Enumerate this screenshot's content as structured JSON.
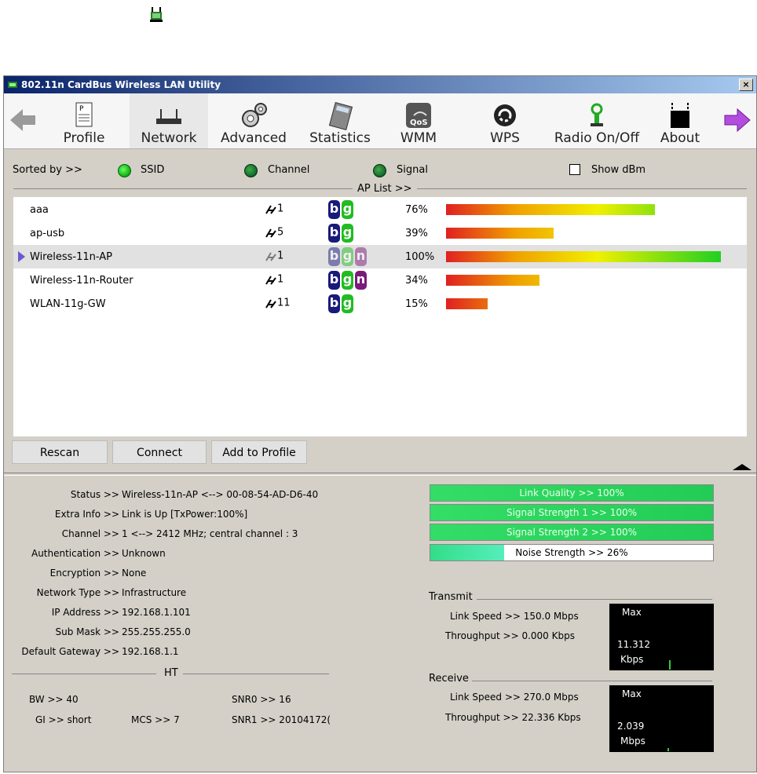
{
  "window": {
    "title": "802.11n CardBus Wireless LAN Utility",
    "close_label": "×"
  },
  "toolbar": {
    "items": [
      {
        "label": "Profile",
        "icon": "profile-icon"
      },
      {
        "label": "Network",
        "icon": "router-icon"
      },
      {
        "label": "Advanced",
        "icon": "gears-icon"
      },
      {
        "label": "Statistics",
        "icon": "calculator-icon"
      },
      {
        "label": "WMM",
        "icon": "qos-icon"
      },
      {
        "label": "WPS",
        "icon": "wps-icon"
      },
      {
        "label": "Radio On/Off",
        "icon": "antenna-icon"
      },
      {
        "label": "About",
        "icon": "about-icon"
      }
    ]
  },
  "sort": {
    "label": "Sorted by >>",
    "ssid": "SSID",
    "channel": "Channel",
    "signal": "Signal",
    "show_dbm": "Show dBm",
    "selected": "SSID"
  },
  "ap_list": {
    "header": "AP List >>",
    "rows": [
      {
        "ssid": "aaa",
        "channel": "1",
        "modes": [
          "b",
          "g"
        ],
        "signal": "76%",
        "signal_value": 76,
        "selected": false
      },
      {
        "ssid": "ap-usb",
        "channel": "5",
        "modes": [
          "b",
          "g"
        ],
        "signal": "39%",
        "signal_value": 39,
        "selected": false
      },
      {
        "ssid": "Wireless-11n-AP",
        "channel": "1",
        "modes": [
          "b",
          "g",
          "n"
        ],
        "signal": "100%",
        "signal_value": 100,
        "selected": true
      },
      {
        "ssid": "Wireless-11n-Router",
        "channel": "1",
        "modes": [
          "b",
          "g",
          "n"
        ],
        "signal": "34%",
        "signal_value": 34,
        "selected": false
      },
      {
        "ssid": "WLAN-11g-GW",
        "channel": "11",
        "modes": [
          "b",
          "g"
        ],
        "signal": "15%",
        "signal_value": 15,
        "selected": false
      }
    ]
  },
  "buttons": {
    "rescan": "Rescan",
    "connect": "Connect",
    "add_to_profile": "Add to Profile"
  },
  "status": {
    "status_label": "Status >>",
    "status_value": "Wireless-11n-AP <--> 00-08-54-AD-D6-40",
    "extra_label": "Extra Info >>",
    "extra_value": "Link is Up [TxPower:100%]",
    "channel_label": "Channel >>",
    "channel_value": "1 <--> 2412 MHz; central channel : 3",
    "auth_label": "Authentication >>",
    "auth_value": "Unknown",
    "enc_label": "Encryption >>",
    "enc_value": "None",
    "nettype_label": "Network Type >>",
    "nettype_value": "Infrastructure",
    "ip_label": "IP Address >>",
    "ip_value": "192.168.1.101",
    "mask_label": "Sub Mask >>",
    "mask_value": "255.255.255.0",
    "gw_label": "Default Gateway >>",
    "gw_value": "192.168.1.1"
  },
  "ht": {
    "header": "HT",
    "bw": "BW >> 40",
    "gi": "GI >> short",
    "mcs": "MCS >> 7",
    "snr0": "SNR0 >> 16",
    "snr1": "SNR1 >> 20104172("
  },
  "meters": [
    {
      "label": "Link Quality >> 100%",
      "value": 100
    },
    {
      "label": "Signal Strength 1 >> 100%",
      "value": 100
    },
    {
      "label": "Signal Strength 2 >> 100%",
      "value": 100
    },
    {
      "label": "Noise Strength >> 26%",
      "value": 26
    }
  ],
  "transmit": {
    "header": "Transmit",
    "link_speed": "Link Speed >> 150.0 Mbps",
    "throughput": "Throughput >> 0.000 Kbps",
    "graph_max": "Max",
    "graph_value": "11.312",
    "graph_unit": "Kbps"
  },
  "receive": {
    "header": "Receive",
    "link_speed": "Link Speed >> 270.0 Mbps",
    "throughput": "Throughput >> 22.336 Kbps",
    "graph_max": "Max",
    "graph_value": "2.039",
    "graph_unit": "Mbps"
  },
  "colors": {
    "mode_b": "#1a1a7a",
    "mode_g": "#22bb22",
    "mode_n": "#7a1a7a",
    "radio_on": "#22cc22",
    "radio_dim": "#2a7a2a"
  }
}
